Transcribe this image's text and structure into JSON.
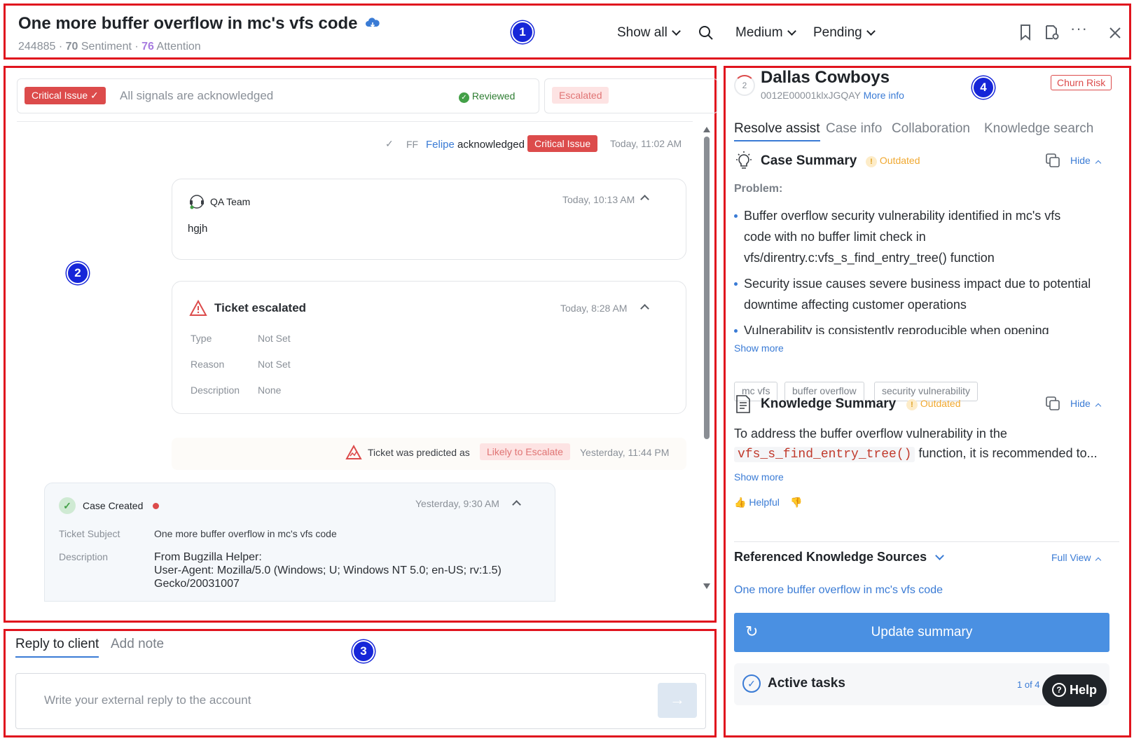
{
  "header": {
    "title": "One more buffer overflow in mc's vfs code",
    "ticket_id": "244885",
    "sentiment_value": "70",
    "sentiment_label": "Sentiment",
    "attention_value": "76",
    "attention_label": "Attention",
    "show_all": "Show all",
    "priority": "Medium",
    "status": "Pending"
  },
  "markers": {
    "m1": "1",
    "m2": "2",
    "m3": "3",
    "m4": "4"
  },
  "tagbar": {
    "critical_label": "Critical Issue",
    "ack_text": "All signals are acknowledged",
    "reviewed": "Reviewed",
    "escalated": "Escalated"
  },
  "timeline": {
    "ack_initials": "FF",
    "ack_user": "Felipe",
    "ack_verb": "acknowledged",
    "ack_tag": "Critical Issue",
    "ack_time": "Today, 11:02 AM",
    "qa_author": "QA Team",
    "qa_time": "Today, 10:13 AM",
    "qa_body": "hgjh",
    "esc_title": "Ticket escalated",
    "esc_time": "Today, 8:28 AM",
    "esc_type_k": "Type",
    "esc_type_v": "Not Set",
    "esc_reason_k": "Reason",
    "esc_reason_v": "Not Set",
    "esc_desc_k": "Description",
    "esc_desc_v": "None",
    "pred_text": "Ticket was predicted as",
    "pred_tag": "Likely to Escalate",
    "pred_time": "Yesterday, 11:44 PM",
    "case_title": "Case Created",
    "case_time": "Yesterday, 9:30 AM",
    "case_subject_k": "Ticket Subject",
    "case_subject_v": "One more buffer overflow in mc's vfs code",
    "case_desc_k": "Description",
    "case_desc_l1": "From Bugzilla Helper:",
    "case_desc_l2": "User-Agent: Mozilla/5.0 (Windows; U; Windows NT 5.0; en-US; rv:1.5)",
    "case_desc_l3": "Gecko/20031007"
  },
  "reply": {
    "tab_reply": "Reply to client",
    "tab_note": "Add note",
    "placeholder": "Write your external reply to the account"
  },
  "account": {
    "rank": "2",
    "name": "Dallas Cowboys",
    "account_id": "0012E00001klxJGQAY",
    "more_info": "More info",
    "churn": "Churn Risk"
  },
  "tabs": [
    "Resolve assist",
    "Case info",
    "Collaboration",
    "Knowledge search"
  ],
  "case_summary": {
    "title": "Case Summary",
    "state": "Outdated",
    "hide": "Hide",
    "problem_label": "Problem:",
    "b1_l1": "Buffer overflow security vulnerability identified in mc's vfs",
    "b1_l2": "code with no buffer limit check in",
    "b1_l3": "vfs/direntry.c:vfs_s_find_entry_tree() function",
    "b2_l1": "Security issue causes severe business impact due to potential",
    "b2_l2": "downtime affecting customer operations",
    "b3_l1": "Vulnerability is consistently reproducible when opening",
    "show_more": "Show more",
    "chips": [
      "mc vfs",
      "buffer overflow",
      "security vulnerability"
    ]
  },
  "knowledge_summary": {
    "title": "Knowledge Summary",
    "state": "Outdated",
    "hide": "Hide",
    "line1": "To address the buffer overflow vulnerability in the",
    "code": "vfs_s_find_entry_tree()",
    "line2_rest": "function, it is recommended to...",
    "show_more": "Show more",
    "helpful": "Helpful"
  },
  "sources": {
    "title": "Referenced Knowledge Sources",
    "full_view": "Full View",
    "link": "One more buffer overflow in mc's vfs code"
  },
  "update_button": "Update summary",
  "tasks": {
    "title": "Active tasks",
    "count": "1 of 4"
  },
  "help": "Help"
}
